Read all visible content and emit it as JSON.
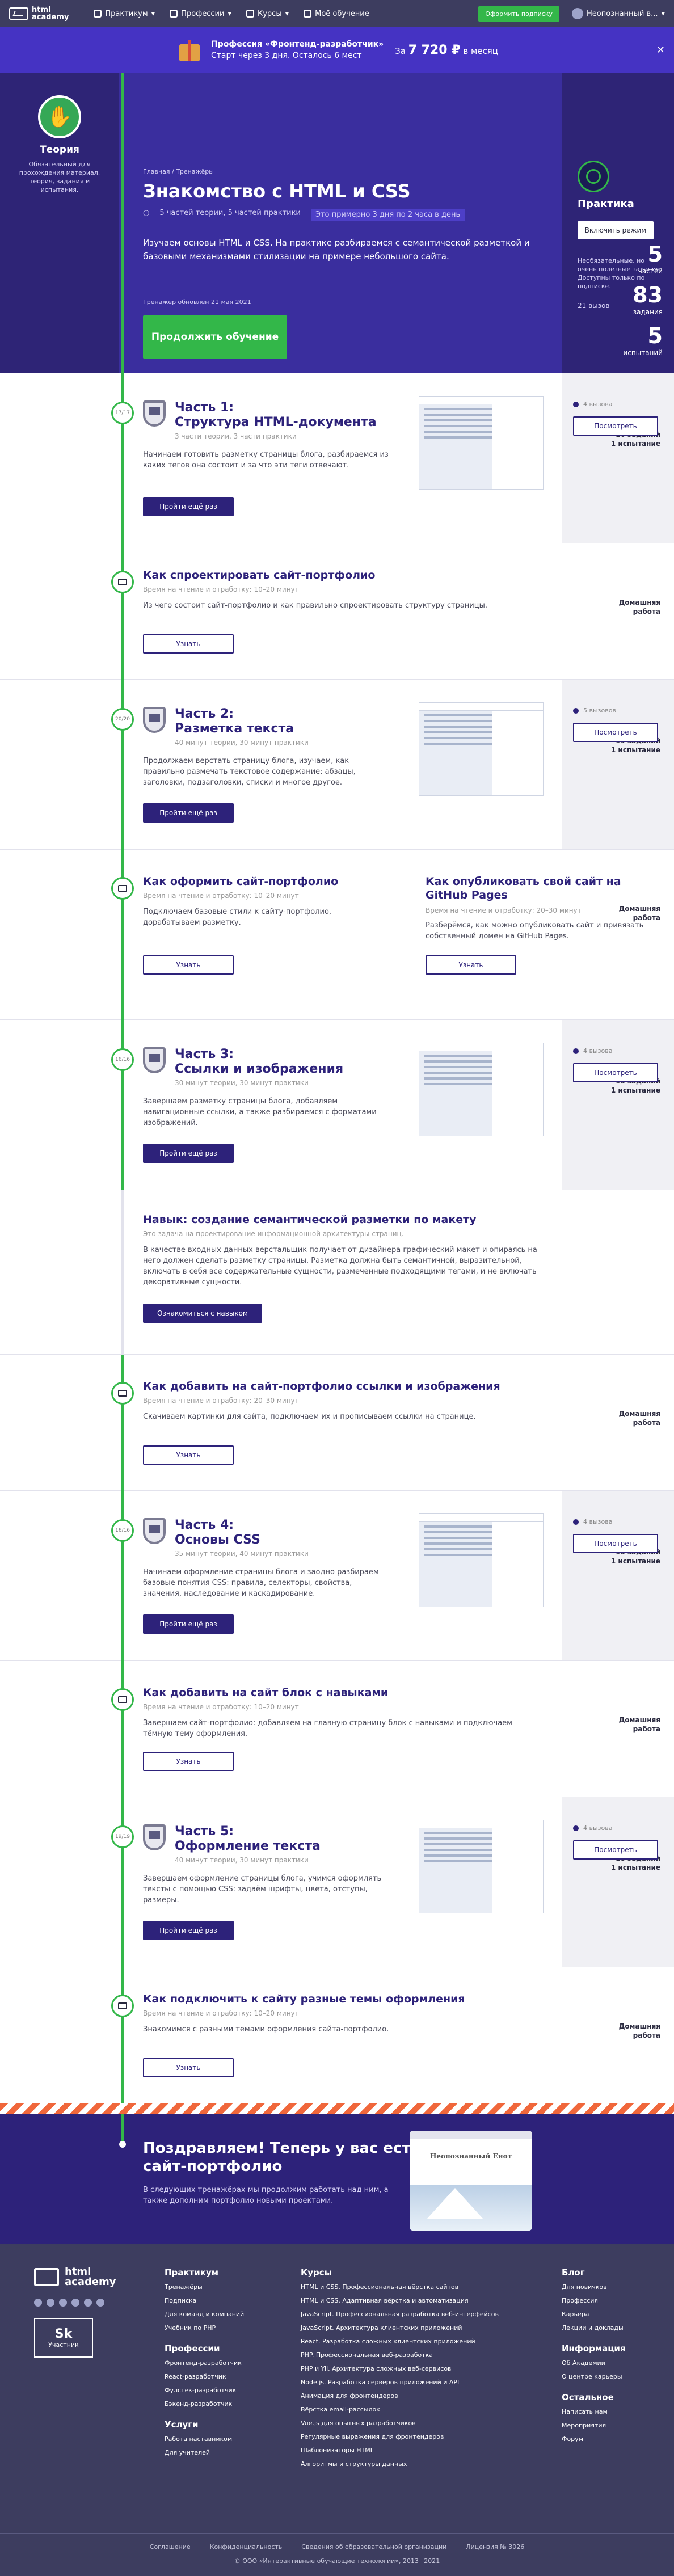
{
  "topnav": {
    "brand_line1": "html",
    "brand_line2": "academy",
    "items": [
      "Практикум",
      "Профессии",
      "Курсы",
      "Моё обучение"
    ],
    "subscribe": "Оформить подписку",
    "user": "Неопознанный в..."
  },
  "promo": {
    "title": "Профессия «Фронтенд-разработчик»",
    "subtitle": "Старт через 3 дня. Осталось 6 мест",
    "price_prefix": "За",
    "price": "7 720 ₽",
    "price_suffix": "в месяц"
  },
  "hero": {
    "theory_title": "Теория",
    "theory_desc": "Обязательный для прохождения материал, теория, задания и испытания.",
    "stats": [
      {
        "n": "5",
        "l": "частей"
      },
      {
        "n": "83",
        "l": "задания"
      },
      {
        "n": "5",
        "l": "испытаний"
      }
    ],
    "crumbs": "Главная  /  Тренажёры",
    "title": "Знакомство с HTML и CSS",
    "meta": [
      "5 частей теории, 5 частей практики",
      "Это примерно 3 дня по 2 часа в день"
    ],
    "desc": "Изучаем основы HTML и CSS. На практике разбираемся с семантической разметкой и базовыми механизмами стилизации на примере небольшого сайта.",
    "updated": "Тренажёр обновлён 21 мая 2021",
    "cta": "Продолжить обучение",
    "practice_title": "Практика",
    "practice_toggle": "Включить режим",
    "practice_note": "Необязательные, но очень полезные задания. Доступны только по подписке.",
    "practice_count": "21 вызов"
  },
  "sections": [
    {
      "type": "part",
      "node": "17/17",
      "left": "16 заданий\n1 испытание",
      "title": "Часть 1:\nСтруктура HTML-документа",
      "sub": "3 части теории, 3 части практики",
      "body": "Начинаем готовить разметку страницы блога, разбираемся из каких тегов она состоит и за что эти теги отвечают.",
      "btn": "Пройти ещё раз",
      "rstat": "4 вызова",
      "rbtn": "Посмотреть"
    },
    {
      "type": "hw",
      "left": "Домашняя\nработа",
      "title": "Как спроектировать сайт-портфолио",
      "sub": "Время на чтение и отработку: 10–20 минут",
      "body": "Из чего состоит сайт-портфолио и как правильно спроектировать структуру страницы.",
      "btn": "Узнать"
    },
    {
      "type": "part",
      "node": "20/20",
      "left": "19 заданий\n1 испытание",
      "title": "Часть 2:\nРазметка текста",
      "sub": "40 минут теории, 30 минут практики",
      "body": "Продолжаем верстать страницу блога, изучаем, как правильно размечать текстовое содержание: абзацы, заголовки, подзаголовки, списки и многое другое.",
      "btn": "Пройти ещё раз",
      "rstat": "5 вызовов",
      "rbtn": "Посмотреть"
    },
    {
      "type": "hw2",
      "left": "Домашняя\nработа",
      "title": "Как оформить сайт-портфолио",
      "sub": "Время на чтение и отработку: 10–20 минут",
      "body": "Подключаем базовые стили к сайту-портфолио, дорабатываем разметку.",
      "btn": "Узнать",
      "title2": "Как опубликовать свой сайт на GitHub Pages",
      "sub2": "Время на чтение и отработку: 20–30 минут",
      "body2": "Разберёмся, как можно опубликовать сайт и привязать собственный домен на GitHub Pages.",
      "btn2": "Узнать"
    },
    {
      "type": "part",
      "node": "16/16",
      "left": "15 заданий\n1 испытание",
      "title": "Часть 3:\nСсылки и изображения",
      "sub": "30 минут теории, 30 минут практики",
      "body": "Завершаем разметку страницы блога, добавляем навигационные ссылки, а также разбираемся с форматами изображений.",
      "btn": "Пройти ещё раз",
      "rstat": "4 вызова",
      "rbtn": "Посмотреть"
    },
    {
      "type": "skill",
      "title": "Навык: создание семантической разметки по макету",
      "sub": "Это задача на проектирование информационной архитектуры страниц.",
      "body": "В качестве входных данных верстальщик получает от дизайнера графический макет и опираясь на него должен сделать разметку страницы. Разметка должна быть семантичной, выразительной, включать в себя все содержательные сущности, размеченные подходящими тегами, и не включать декоративные сущности.",
      "btn": "Ознакомиться с навыком"
    },
    {
      "type": "hw",
      "left": "Домашняя\nработа",
      "title": "Как добавить на сайт-портфолио ссылки и изображения",
      "sub": "Время на чтение и отработку: 20–30 минут",
      "body": "Скачиваем картинки для сайта, подключаем их и прописываем ссылки на странице.",
      "btn": "Узнать"
    },
    {
      "type": "part",
      "node": "16/16",
      "left": "15 заданий\n1 испытание",
      "title": "Часть 4:\nОсновы CSS",
      "sub": "35 минут теории, 40 минут практики",
      "body": "Начинаем оформление страницы блога и заодно разбираем базовые понятия CSS: правила, селекторы, свойства, значения, наследование и каскадирование.",
      "btn": "Пройти ещё раз",
      "rstat": "4 вызова",
      "rbtn": "Посмотреть"
    },
    {
      "type": "hw",
      "left": "Домашняя\nработа",
      "title": "Как добавить на сайт блок с навыками",
      "sub": "Время на чтение и отработку: 10–20 минут",
      "body": "Завершаем сайт-портфолио: добавляем на главную страницу блок с навыками и подключаем тёмную тему оформления.",
      "btn": "Узнать"
    },
    {
      "type": "part",
      "node": "19/19",
      "left": "18 заданий\n1 испытание",
      "title": "Часть 5:\nОформление текста",
      "sub": "40 минут теории, 30 минут практики",
      "body": "Завершаем оформление страницы блога, учимся оформлять тексты с помощью CSS: задаём шрифты, цвета, отступы, размеры.",
      "btn": "Пройти ещё раз",
      "rstat": "4 вызова",
      "rbtn": "Посмотреть"
    },
    {
      "type": "hw",
      "left": "Домашняя\nработа",
      "title": "Как подключить к сайту разные темы оформления",
      "sub": "Время на чтение и отработку: 10–20 минут",
      "body": "Знакомимся с разными темами оформления сайта-портфолио.",
      "btn": "Узнать"
    }
  ],
  "congrats": {
    "title": "Поздравляем! Теперь у вас есть сайт-портфолио",
    "body": "В следующих тренажёрах мы продолжим работать над ним, а также дополним портфолио новыми проектами.",
    "card_title": "Неопознанный Енот"
  },
  "footer": {
    "brand_line1": "html",
    "brand_line2": "academy",
    "sk_label": "Участник",
    "col1": {
      "h": "Практикум",
      "items": [
        "Тренажёры",
        "Подписка",
        "Для команд и компаний",
        "Учебник по PHP"
      ],
      "h2": "Профессии",
      "items2": [
        "Фронтенд-разработчик",
        "React-разработчик",
        "Фулстек-разработчик",
        "Бэкенд-разработчик"
      ],
      "h3": "Услуги",
      "items3": [
        "Работа наставником",
        "Для учителей"
      ]
    },
    "col2": {
      "h": "Курсы",
      "items": [
        "HTML и CSS. Профессиональная вёрстка сайтов",
        "HTML и CSS. Адаптивная вёрстка и автоматизация",
        "JavaScript. Профессиональная разработка веб-интерфейсов",
        "JavaScript. Архитектура клиентских приложений",
        "React. Разработка сложных клиентских приложений",
        "PHP. Профессиональная веб-разработка",
        "PHP и Yii. Архитектура сложных веб-сервисов",
        "Node.js. Разработка серверов приложений и API",
        "Анимация для фронтендеров",
        "Вёрстка email-рассылок",
        "Vue.js для опытных разработчиков",
        "Регулярные выражения для фронтендеров",
        "Шаблонизаторы HTML",
        "Алгоритмы и структуры данных"
      ]
    },
    "col3": {
      "h": "Блог",
      "items": [
        "Для новичков",
        "Профессия",
        "Карьера",
        "Лекции и доклады"
      ],
      "h2": "Информация",
      "items2": [
        "Об Академии",
        "О центре карьеры"
      ],
      "h3": "Остальное",
      "items3": [
        "Написать нам",
        "Мероприятия",
        "Форум"
      ]
    },
    "bottom": [
      "Соглашение",
      "Конфиденциальность",
      "Сведения об образовательной организации",
      "Лицензия № 3026"
    ],
    "copyright": "© ООО «Интерактивные обучающие технологии», 2013−2021"
  }
}
